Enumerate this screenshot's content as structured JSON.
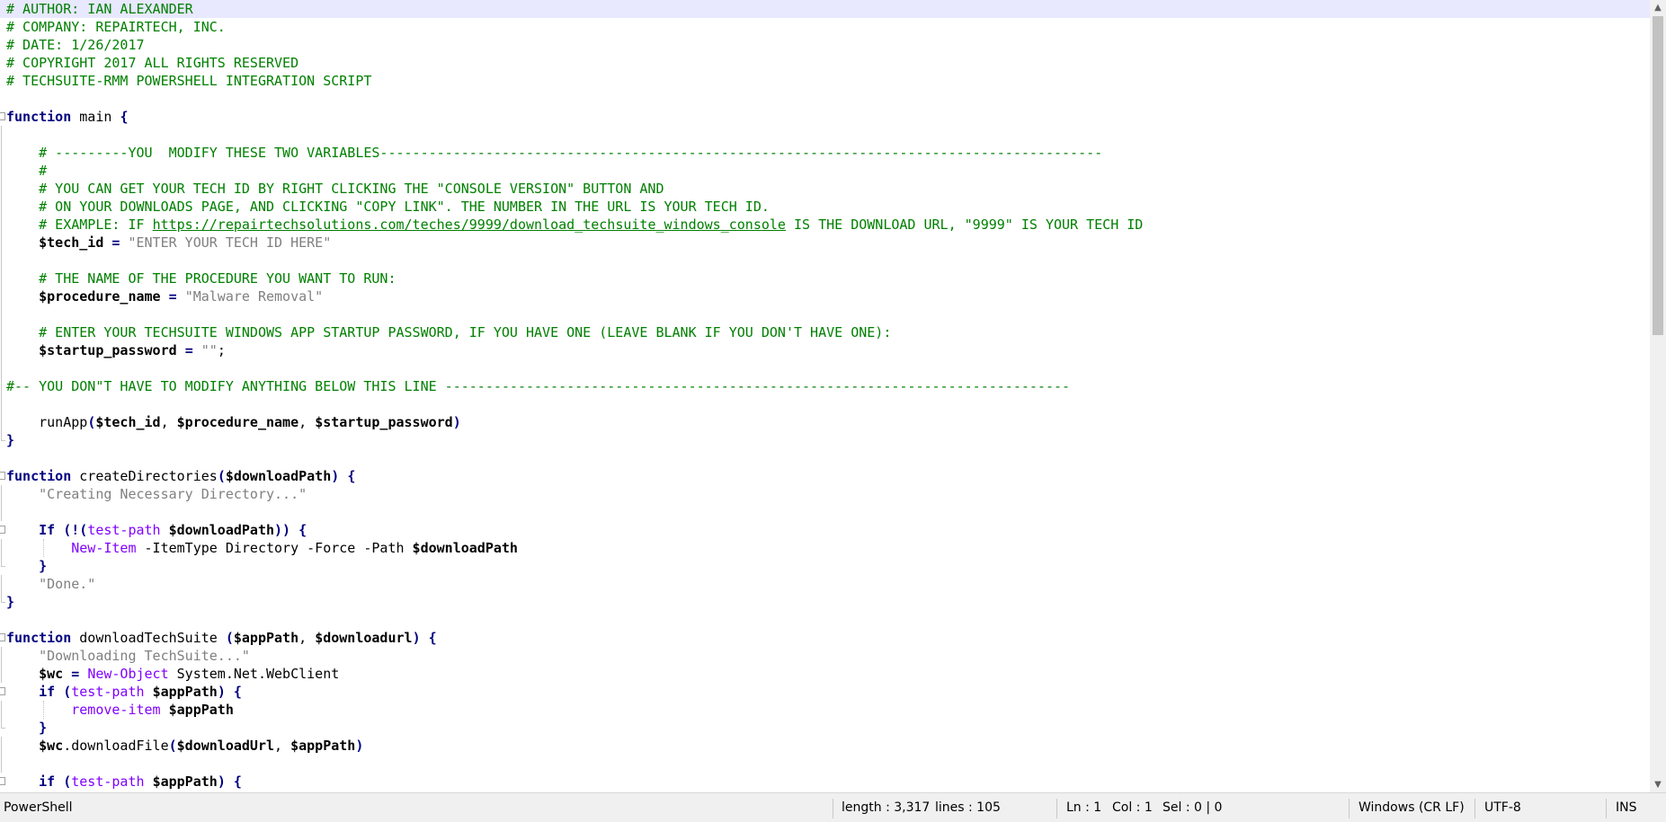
{
  "editor": {
    "lines": [
      {
        "current": true,
        "fold": "",
        "tokens": [
          {
            "t": "comment",
            "v": "# AUTHOR: IAN ALEXANDER"
          }
        ]
      },
      {
        "fold": "",
        "tokens": [
          {
            "t": "comment",
            "v": "# COMPANY: REPAIRTECH, INC."
          }
        ]
      },
      {
        "fold": "",
        "tokens": [
          {
            "t": "comment",
            "v": "# DATE: 1/26/2017"
          }
        ]
      },
      {
        "fold": "",
        "tokens": [
          {
            "t": "comment",
            "v": "# COPYRIGHT 2017 ALL RIGHTS RESERVED"
          }
        ]
      },
      {
        "fold": "",
        "tokens": [
          {
            "t": "comment",
            "v": "# TECHSUITE-RMM POWERSHELL INTEGRATION SCRIPT"
          }
        ]
      },
      {
        "fold": "",
        "tokens": []
      },
      {
        "fold": "start",
        "tokens": [
          {
            "t": "keyword",
            "v": "function"
          },
          {
            "t": "plain",
            "v": " main "
          },
          {
            "t": "op",
            "v": "{"
          }
        ]
      },
      {
        "fold": "bar",
        "tokens": []
      },
      {
        "fold": "bar",
        "tokens": [
          {
            "t": "plain",
            "v": "    "
          },
          {
            "t": "comment",
            "v": "# ---------YOU  MODIFY THESE TWO VARIABLES-----------------------------------------------------------------------------------------"
          }
        ]
      },
      {
        "fold": "bar",
        "tokens": [
          {
            "t": "plain",
            "v": "    "
          },
          {
            "t": "comment",
            "v": "#"
          }
        ]
      },
      {
        "fold": "bar",
        "tokens": [
          {
            "t": "plain",
            "v": "    "
          },
          {
            "t": "comment",
            "v": "# YOU CAN GET YOUR TECH ID BY RIGHT CLICKING THE \"CONSOLE VERSION\" BUTTON AND"
          }
        ]
      },
      {
        "fold": "bar",
        "tokens": [
          {
            "t": "plain",
            "v": "    "
          },
          {
            "t": "comment",
            "v": "# ON YOUR DOWNLOADS PAGE, AND CLICKING \"COPY LINK\". THE NUMBER IN THE URL IS YOUR TECH ID."
          }
        ]
      },
      {
        "fold": "bar",
        "tokens": [
          {
            "t": "plain",
            "v": "    "
          },
          {
            "t": "comment",
            "v": "# EXAMPLE: IF "
          },
          {
            "t": "link",
            "v": "https://repairtechsolutions.com/teches/9999/download_techsuite_windows_console"
          },
          {
            "t": "comment",
            "v": " IS THE DOWNLOAD URL, \"9999\" IS YOUR TECH ID"
          }
        ]
      },
      {
        "fold": "bar",
        "tokens": [
          {
            "t": "plain",
            "v": "    "
          },
          {
            "t": "var",
            "v": "$tech_id"
          },
          {
            "t": "plain",
            "v": " "
          },
          {
            "t": "op",
            "v": "="
          },
          {
            "t": "plain",
            "v": " "
          },
          {
            "t": "str",
            "v": "\"ENTER YOUR TECH ID HERE\""
          }
        ]
      },
      {
        "fold": "bar",
        "tokens": []
      },
      {
        "fold": "bar",
        "tokens": [
          {
            "t": "plain",
            "v": "    "
          },
          {
            "t": "comment",
            "v": "# THE NAME OF THE PROCEDURE YOU WANT TO RUN:"
          }
        ]
      },
      {
        "fold": "bar",
        "tokens": [
          {
            "t": "plain",
            "v": "    "
          },
          {
            "t": "var",
            "v": "$procedure_name"
          },
          {
            "t": "plain",
            "v": " "
          },
          {
            "t": "op",
            "v": "="
          },
          {
            "t": "plain",
            "v": " "
          },
          {
            "t": "str",
            "v": "\"Malware Removal\""
          }
        ]
      },
      {
        "fold": "bar",
        "tokens": []
      },
      {
        "fold": "bar",
        "tokens": [
          {
            "t": "plain",
            "v": "    "
          },
          {
            "t": "comment",
            "v": "# ENTER YOUR TECHSUITE WINDOWS APP STARTUP PASSWORD, IF YOU HAVE ONE (LEAVE BLANK IF YOU DON'T HAVE ONE):"
          }
        ]
      },
      {
        "fold": "bar",
        "tokens": [
          {
            "t": "plain",
            "v": "    "
          },
          {
            "t": "var",
            "v": "$startup_password"
          },
          {
            "t": "plain",
            "v": " "
          },
          {
            "t": "op",
            "v": "="
          },
          {
            "t": "plain",
            "v": " "
          },
          {
            "t": "str",
            "v": "\"\""
          },
          {
            "t": "plain",
            "v": ";"
          }
        ]
      },
      {
        "fold": "bar",
        "tokens": []
      },
      {
        "fold": "bar",
        "tokens": [
          {
            "t": "comment",
            "v": "#-- YOU DON\"T HAVE TO MODIFY ANYTHING BELOW THIS LINE -----------------------------------------------------------------------------"
          }
        ]
      },
      {
        "fold": "bar",
        "tokens": []
      },
      {
        "fold": "bar",
        "tokens": [
          {
            "t": "plain",
            "v": "    runApp"
          },
          {
            "t": "op",
            "v": "("
          },
          {
            "t": "var",
            "v": "$tech_id"
          },
          {
            "t": "plain",
            "v": ", "
          },
          {
            "t": "var",
            "v": "$procedure_name"
          },
          {
            "t": "plain",
            "v": ", "
          },
          {
            "t": "var",
            "v": "$startup_password"
          },
          {
            "t": "op",
            "v": ")"
          }
        ]
      },
      {
        "fold": "end",
        "tokens": [
          {
            "t": "op",
            "v": "}"
          }
        ]
      },
      {
        "fold": "",
        "tokens": []
      },
      {
        "fold": "start",
        "tokens": [
          {
            "t": "keyword",
            "v": "function"
          },
          {
            "t": "plain",
            "v": " createDirectories"
          },
          {
            "t": "op",
            "v": "("
          },
          {
            "t": "var",
            "v": "$downloadPath"
          },
          {
            "t": "op",
            "v": ")"
          },
          {
            "t": "plain",
            "v": " "
          },
          {
            "t": "op",
            "v": "{"
          }
        ]
      },
      {
        "fold": "bar",
        "tokens": [
          {
            "t": "plain",
            "v": "    "
          },
          {
            "t": "str",
            "v": "\"Creating Necessary Directory...\""
          }
        ]
      },
      {
        "fold": "bar",
        "tokens": []
      },
      {
        "fold": "start2",
        "tokens": [
          {
            "t": "plain",
            "v": "    "
          },
          {
            "t": "keyword",
            "v": "If"
          },
          {
            "t": "plain",
            "v": " "
          },
          {
            "t": "op",
            "v": "(!("
          },
          {
            "t": "cmdlet",
            "v": "test-path"
          },
          {
            "t": "plain",
            "v": " "
          },
          {
            "t": "var",
            "v": "$downloadPath"
          },
          {
            "t": "op",
            "v": "))"
          },
          {
            "t": "plain",
            "v": " "
          },
          {
            "t": "op",
            "v": "{"
          }
        ]
      },
      {
        "fold": "bar",
        "guide": true,
        "tokens": [
          {
            "t": "plain",
            "v": "        "
          },
          {
            "t": "cmdlet",
            "v": "New-Item"
          },
          {
            "t": "plain",
            "v": " -ItemType Directory -Force -Path "
          },
          {
            "t": "var",
            "v": "$downloadPath"
          }
        ]
      },
      {
        "fold": "end2",
        "tokens": [
          {
            "t": "plain",
            "v": "    "
          },
          {
            "t": "op",
            "v": "}"
          }
        ]
      },
      {
        "fold": "bar",
        "tokens": [
          {
            "t": "plain",
            "v": "    "
          },
          {
            "t": "str",
            "v": "\"Done.\""
          }
        ]
      },
      {
        "fold": "end",
        "tokens": [
          {
            "t": "op",
            "v": "}"
          }
        ]
      },
      {
        "fold": "",
        "tokens": []
      },
      {
        "fold": "start",
        "tokens": [
          {
            "t": "keyword",
            "v": "function"
          },
          {
            "t": "plain",
            "v": " downloadTechSuite "
          },
          {
            "t": "op",
            "v": "("
          },
          {
            "t": "var",
            "v": "$appPath"
          },
          {
            "t": "plain",
            "v": ", "
          },
          {
            "t": "var",
            "v": "$downloadurl"
          },
          {
            "t": "op",
            "v": ")"
          },
          {
            "t": "plain",
            "v": " "
          },
          {
            "t": "op",
            "v": "{"
          }
        ]
      },
      {
        "fold": "bar",
        "tokens": [
          {
            "t": "plain",
            "v": "    "
          },
          {
            "t": "str",
            "v": "\"Downloading TechSuite...\""
          }
        ]
      },
      {
        "fold": "bar",
        "tokens": [
          {
            "t": "plain",
            "v": "    "
          },
          {
            "t": "var",
            "v": "$wc"
          },
          {
            "t": "plain",
            "v": " "
          },
          {
            "t": "op",
            "v": "="
          },
          {
            "t": "plain",
            "v": " "
          },
          {
            "t": "cmdlet",
            "v": "New-Object"
          },
          {
            "t": "plain",
            "v": " System.Net.WebClient"
          }
        ]
      },
      {
        "fold": "start2",
        "tokens": [
          {
            "t": "plain",
            "v": "    "
          },
          {
            "t": "keyword",
            "v": "if"
          },
          {
            "t": "plain",
            "v": " "
          },
          {
            "t": "op",
            "v": "("
          },
          {
            "t": "cmdlet",
            "v": "test-path"
          },
          {
            "t": "plain",
            "v": " "
          },
          {
            "t": "var",
            "v": "$appPath"
          },
          {
            "t": "op",
            "v": ")"
          },
          {
            "t": "plain",
            "v": " "
          },
          {
            "t": "op",
            "v": "{"
          }
        ]
      },
      {
        "fold": "bar",
        "guide": true,
        "tokens": [
          {
            "t": "plain",
            "v": "        "
          },
          {
            "t": "cmdlet",
            "v": "remove-item"
          },
          {
            "t": "plain",
            "v": " "
          },
          {
            "t": "var",
            "v": "$appPath"
          }
        ]
      },
      {
        "fold": "end2",
        "tokens": [
          {
            "t": "plain",
            "v": "    "
          },
          {
            "t": "op",
            "v": "}"
          }
        ]
      },
      {
        "fold": "bar",
        "tokens": [
          {
            "t": "plain",
            "v": "    "
          },
          {
            "t": "var",
            "v": "$wc"
          },
          {
            "t": "plain",
            "v": ".downloadFile"
          },
          {
            "t": "op",
            "v": "("
          },
          {
            "t": "var",
            "v": "$downloadUrl"
          },
          {
            "t": "plain",
            "v": ", "
          },
          {
            "t": "var",
            "v": "$appPath"
          },
          {
            "t": "op",
            "v": ")"
          }
        ]
      },
      {
        "fold": "bar",
        "tokens": []
      },
      {
        "fold": "start2",
        "tokens": [
          {
            "t": "plain",
            "v": "    "
          },
          {
            "t": "keyword",
            "v": "if"
          },
          {
            "t": "plain",
            "v": " "
          },
          {
            "t": "op",
            "v": "("
          },
          {
            "t": "cmdlet",
            "v": "test-path"
          },
          {
            "t": "plain",
            "v": " "
          },
          {
            "t": "var",
            "v": "$appPath"
          },
          {
            "t": "op",
            "v": ")"
          },
          {
            "t": "plain",
            "v": " "
          },
          {
            "t": "op",
            "v": "{"
          }
        ]
      }
    ]
  },
  "scrollbar": {
    "up_icon": "chevron-up-icon",
    "down_icon": "chevron-down-icon",
    "up_glyph": "▲",
    "down_glyph": "▼"
  },
  "statusbar": {
    "language": "PowerShell",
    "length": "length : 3,317",
    "lines": "lines : 105",
    "ln": "Ln : 1",
    "col": "Col : 1",
    "sel": "Sel : 0 | 0",
    "eol": "Windows (CR LF)",
    "encoding": "UTF-8",
    "mode": "INS"
  },
  "colors": {
    "comment": "#008000",
    "keyword": "#000080",
    "string": "#808080",
    "cmdlet": "#8000ff",
    "current_line": "#e8e8ff"
  }
}
